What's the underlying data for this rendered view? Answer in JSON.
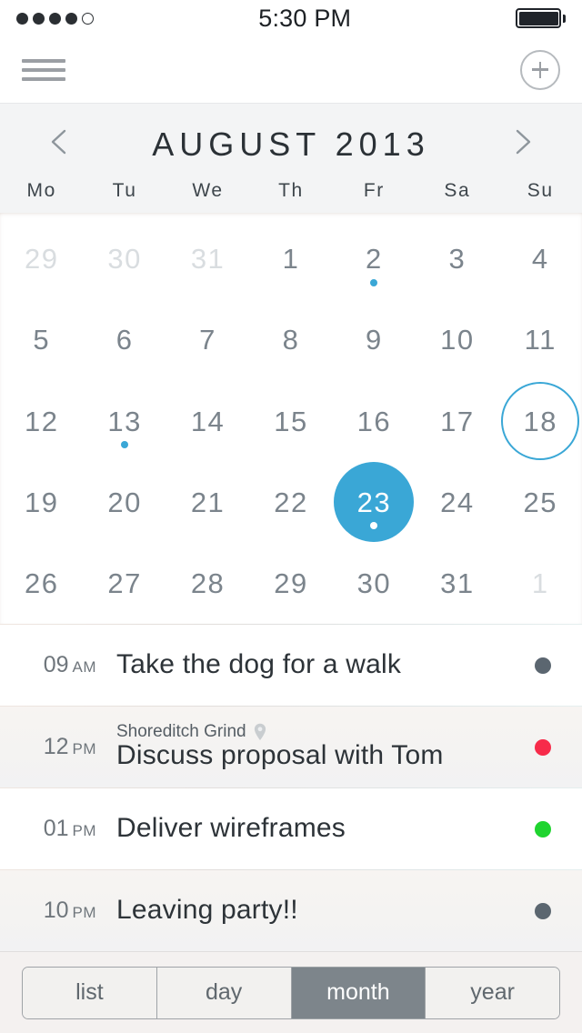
{
  "status_bar": {
    "signal_dots_total": 5,
    "signal_dots_filled": 4,
    "time": "5:30 PM",
    "battery_icon": "battery-full-icon"
  },
  "nav_bar": {
    "menu_icon": "hamburger-menu-icon",
    "add_icon": "plus-circle-icon"
  },
  "month_header": {
    "prev_icon": "chevron-left-icon",
    "next_icon": "chevron-right-icon",
    "title": "AUGUST 2013",
    "weekdays": [
      "Mo",
      "Tu",
      "We",
      "Th",
      "Fr",
      "Sa",
      "Su"
    ]
  },
  "colors": {
    "accent_blue": "#3aa7d6",
    "dot_gray": "#5b6670",
    "dot_red": "#f72b4a",
    "dot_green": "#1fd42f",
    "header_bg": "#f3f4f5",
    "muted_day": "#d9dde0",
    "day_text": "#7b848c"
  },
  "calendar": {
    "weeks": [
      [
        {
          "num": "29",
          "muted": true
        },
        {
          "num": "30",
          "muted": true
        },
        {
          "num": "31",
          "muted": true
        },
        {
          "num": "1",
          "muted": false
        },
        {
          "num": "2",
          "muted": false,
          "dot": "#3aa7d6"
        },
        {
          "num": "3",
          "muted": false
        },
        {
          "num": "4",
          "muted": false
        }
      ],
      [
        {
          "num": "5",
          "muted": false
        },
        {
          "num": "6",
          "muted": false
        },
        {
          "num": "7",
          "muted": false
        },
        {
          "num": "8",
          "muted": false
        },
        {
          "num": "9",
          "muted": false
        },
        {
          "num": "10",
          "muted": false
        },
        {
          "num": "11",
          "muted": false
        }
      ],
      [
        {
          "num": "12",
          "muted": false
        },
        {
          "num": "13",
          "muted": false,
          "dot": "#3aa7d6"
        },
        {
          "num": "14",
          "muted": false
        },
        {
          "num": "15",
          "muted": false
        },
        {
          "num": "16",
          "muted": false
        },
        {
          "num": "17",
          "muted": false
        },
        {
          "num": "18",
          "muted": false,
          "today": true
        }
      ],
      [
        {
          "num": "19",
          "muted": false
        },
        {
          "num": "20",
          "muted": false
        },
        {
          "num": "21",
          "muted": false
        },
        {
          "num": "22",
          "muted": false
        },
        {
          "num": "23",
          "muted": false,
          "selected": true,
          "dot": "#ffffff"
        },
        {
          "num": "24",
          "muted": false
        },
        {
          "num": "25",
          "muted": false
        }
      ],
      [
        {
          "num": "26",
          "muted": false
        },
        {
          "num": "27",
          "muted": false
        },
        {
          "num": "28",
          "muted": false
        },
        {
          "num": "29",
          "muted": false
        },
        {
          "num": "30",
          "muted": false
        },
        {
          "num": "31",
          "muted": false
        },
        {
          "num": "1",
          "muted": true
        }
      ]
    ]
  },
  "events": [
    {
      "hour": "09",
      "meridiem": "AM",
      "title": "Take the dog for a walk",
      "location": "",
      "dot_color": "#5b6670",
      "tinted": false
    },
    {
      "hour": "12",
      "meridiem": "PM",
      "title": "Discuss proposal with Tom",
      "location": "Shoreditch Grind",
      "location_icon": "map-pin-icon",
      "dot_color": "#f72b4a",
      "tinted": true
    },
    {
      "hour": "01",
      "meridiem": "PM",
      "title": "Deliver wireframes",
      "location": "",
      "dot_color": "#1fd42f",
      "tinted": false
    },
    {
      "hour": "10",
      "meridiem": "PM",
      "title": "Leaving party!!",
      "location": "",
      "dot_color": "#5b6670",
      "tinted": true
    }
  ],
  "tabbar": {
    "segments": [
      {
        "label": "list",
        "active": false
      },
      {
        "label": "day",
        "active": false
      },
      {
        "label": "month",
        "active": true
      },
      {
        "label": "year",
        "active": false
      }
    ]
  }
}
